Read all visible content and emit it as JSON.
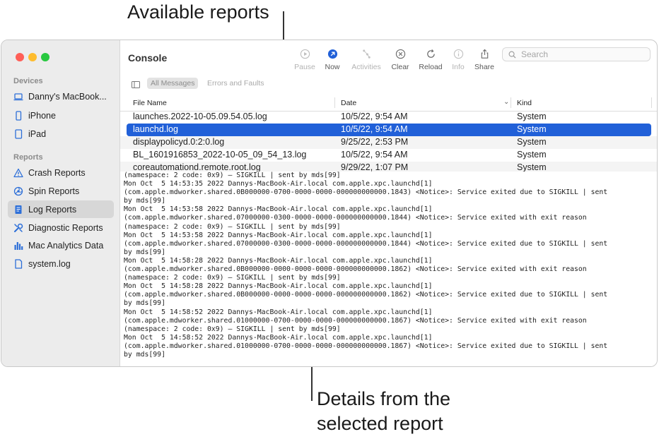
{
  "callouts": {
    "top": "Available reports",
    "bottom_line1": "Details from the",
    "bottom_line2": "selected report"
  },
  "sidebar": {
    "devices_header": "Devices",
    "devices": [
      {
        "label": "Danny's MacBook...",
        "icon": "laptop-icon"
      },
      {
        "label": "iPhone",
        "icon": "iphone-icon"
      },
      {
        "label": "iPad",
        "icon": "ipad-icon"
      }
    ],
    "reports_header": "Reports",
    "reports": [
      {
        "label": "Crash Reports",
        "icon": "warning-icon"
      },
      {
        "label": "Spin Reports",
        "icon": "spin-icon"
      },
      {
        "label": "Log Reports",
        "icon": "document-icon",
        "selected": true
      },
      {
        "label": "Diagnostic Reports",
        "icon": "wrench-icon"
      },
      {
        "label": "Mac Analytics Data",
        "icon": "bar-chart-icon"
      },
      {
        "label": "system.log",
        "icon": "file-icon"
      }
    ]
  },
  "toolbar": {
    "title": "Console",
    "pause": "Pause",
    "now": "Now",
    "activities": "Activities",
    "clear": "Clear",
    "reload": "Reload",
    "info": "Info",
    "share": "Share",
    "search_placeholder": "Search",
    "accent": "#2160d8"
  },
  "filter": {
    "all_messages": "All Messages",
    "errors_faults": "Errors and Faults"
  },
  "table": {
    "headers": {
      "file": "File Name",
      "date": "Date",
      "kind": "Kind"
    },
    "rows": [
      {
        "file": "launches.2022-10-05.09.54.05.log",
        "date": "10/5/22, 9:54 AM",
        "kind": "System"
      },
      {
        "file": "launchd.log",
        "date": "10/5/22, 9:54 AM",
        "kind": "System",
        "selected": true
      },
      {
        "file": "displaypolicyd.0:2:0.log",
        "date": "9/25/22, 2:53 PM",
        "kind": "System"
      },
      {
        "file": "BL_1601916853_2022-10-05_09_54_13.log",
        "date": "10/5/22, 9:54 AM",
        "kind": "System"
      },
      {
        "file": "coreautomationd.remote.root.log",
        "date": "9/29/22, 1:07 PM",
        "kind": "System"
      }
    ]
  },
  "details": {
    "lines": [
      "(namespace: 2 code: 0x9) – SIGKILL | sent by mds[99]",
      "Mon Oct  5 14:53:35 2022 Dannys-MacBook-Air.local com.apple.xpc.launchd[1]",
      "(com.apple.mdworker.shared.0B000000-0700-0000-0000-000000000000.1843) <Notice>: Service exited due to SIGKILL | sent",
      "by mds[99]",
      "Mon Oct  5 14:53:58 2022 Dannys-MacBook-Air.local com.apple.xpc.launchd[1]",
      "(com.apple.mdworker.shared.07000000-0300-0000-0000-000000000000.1844) <Notice>: Service exited with exit reason",
      "(namespace: 2 code: 0x9) – SIGKILL | sent by mds[99]",
      "Mon Oct  5 14:53:58 2022 Dannys-MacBook-Air.local com.apple.xpc.launchd[1]",
      "(com.apple.mdworker.shared.07000000-0300-0000-0000-000000000000.1844) <Notice>: Service exited due to SIGKILL | sent",
      "by mds[99]",
      "Mon Oct  5 14:58:28 2022 Dannys-MacBook-Air.local com.apple.xpc.launchd[1]",
      "(com.apple.mdworker.shared.0B000000-0000-0000-0000-000000000000.1862) <Notice>: Service exited with exit reason",
      "(namespace: 2 code: 0x9) – SIGKILL | sent by mds[99]",
      "Mon Oct  5 14:58:28 2022 Dannys-MacBook-Air.local com.apple.xpc.launchd[1]",
      "(com.apple.mdworker.shared.0B000000-0000-0000-0000-000000000000.1862) <Notice>: Service exited due to SIGKILL | sent",
      "by mds[99]",
      "Mon Oct  5 14:58:52 2022 Dannys-MacBook-Air.local com.apple.xpc.launchd[1]",
      "(com.apple.mdworker.shared.01000000-0700-0000-0000-000000000000.1867) <Notice>: Service exited with exit reason",
      "(namespace: 2 code: 0x9) – SIGKILL | sent by mds[99]",
      "Mon Oct  5 14:58:52 2022 Dannys-MacBook-Air.local com.apple.xpc.launchd[1]",
      "(com.apple.mdworker.shared.01000000-0700-0000-0000-000000000000.1867) <Notice>: Service exited due to SIGKILL | sent",
      "by mds[99]"
    ]
  }
}
